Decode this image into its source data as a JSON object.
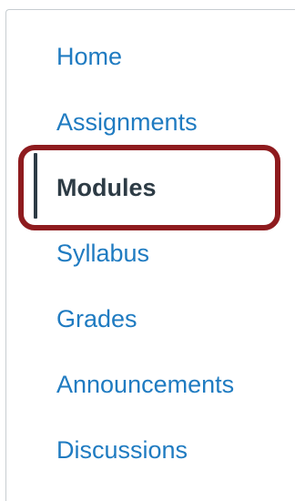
{
  "nav": {
    "items": [
      {
        "label": "Home"
      },
      {
        "label": "Assignments"
      },
      {
        "label": "Modules",
        "active": true
      },
      {
        "label": "Syllabus"
      },
      {
        "label": "Grades"
      },
      {
        "label": "Announcements"
      },
      {
        "label": "Discussions"
      }
    ]
  },
  "colors": {
    "link": "#1f7bc1",
    "active_text": "#2d3b45",
    "highlight_border": "#8e1b1e",
    "frame_border": "#c7cdd1"
  }
}
